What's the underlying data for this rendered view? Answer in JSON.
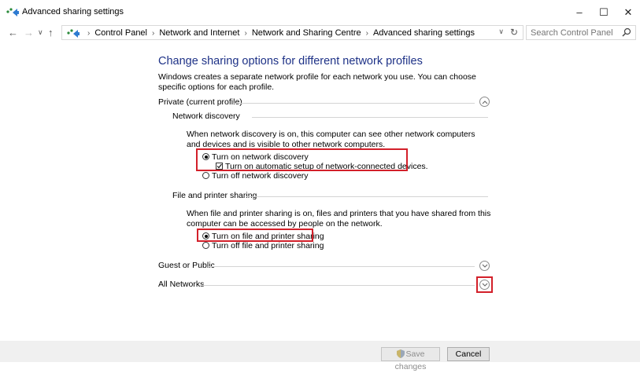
{
  "window": {
    "title": "Advanced sharing settings",
    "minimize_glyph": "–",
    "maximize_glyph": "☐",
    "close_glyph": "✕"
  },
  "address_bar": {
    "breadcrumbs": [
      "Control Panel",
      "Network and Internet",
      "Network and Sharing Centre",
      "Advanced sharing settings"
    ],
    "search_placeholder": "Search Control Panel"
  },
  "main": {
    "heading": "Change sharing options for different network profiles",
    "intro": "Windows creates a separate network profile for each network you use. You can choose specific options for each profile.",
    "profiles": {
      "private": {
        "label": "Private (current profile)",
        "expanded": true,
        "network_discovery": {
          "label": "Network discovery",
          "description": "When network discovery is on, this computer can see other network computers and devices and is visible to other network computers.",
          "option_on": "Turn on network discovery",
          "option_auto": "Turn on automatic setup of network-connected devices.",
          "option_off": "Turn off network discovery",
          "selected": "on",
          "auto_setup_checked": true
        },
        "file_printer_sharing": {
          "label": "File and printer sharing",
          "description": "When file and printer sharing is on, files and printers that you have shared from this computer can be accessed by people on the network.",
          "option_on": "Turn on file and printer sharing",
          "option_off": "Turn off file and printer sharing",
          "selected": "on"
        }
      },
      "guest": {
        "label": "Guest or Public",
        "expanded": false
      },
      "all": {
        "label": "All Networks",
        "expanded": false
      }
    }
  },
  "footer": {
    "save_label": "Save changes",
    "cancel_label": "Cancel"
  },
  "colors": {
    "heading": "#1e3287",
    "highlight": "#d3202a"
  }
}
